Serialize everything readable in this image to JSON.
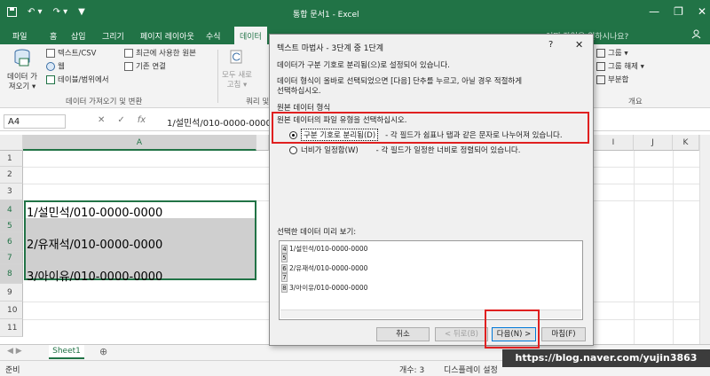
{
  "titlebar": {
    "title": "통합 문서1 - Excel",
    "qat": [
      "↶ ▾",
      "↷ ▾",
      "▼"
    ],
    "controls": [
      "—",
      "❐",
      "✕"
    ]
  },
  "tabs": [
    {
      "label": "파일"
    },
    {
      "label": "홈"
    },
    {
      "label": "삽입"
    },
    {
      "label": "그리기"
    },
    {
      "label": "페이지 레이아웃"
    },
    {
      "label": "수식"
    },
    {
      "label": "데이터"
    }
  ],
  "tell_me": "어떤 작업을 원하시나요?",
  "ribbon": {
    "get_data": "데이터 가\n져오기 ▾",
    "from_text_csv": "텍스트/CSV",
    "from_web": "웹",
    "from_table": "테이블/범위에서",
    "recent_sources": "최근에 사용한 원본",
    "existing_connections": "기존 연결",
    "group_get_transform": "데이터 가져오기 및 변환",
    "refresh_all": "모두 새로\n고침 ▾",
    "group_queries": "쿼리 및",
    "group": "그룹 ▾",
    "ungroup": "그룹 해제 ▾",
    "subtotal": "부분합",
    "group_outline": "개요"
  },
  "formula_bar": {
    "name_box": "A4",
    "cancel": "✕",
    "enter": "✓",
    "fx": "fx",
    "formula": "1/설민석/010-0000-0000"
  },
  "columns": [
    "A",
    "I",
    "J",
    "K"
  ],
  "rows": [
    "1",
    "2",
    "3",
    "4",
    "5",
    "6",
    "7",
    "8",
    "9",
    "10",
    "11"
  ],
  "cells": {
    "a4": "1/설민석/010-0000-0000",
    "a6": "2/유재석/010-0000-0000",
    "a8": "3/아이유/010-0000-0000"
  },
  "sheet": {
    "tab": "Sheet1",
    "add": "⊕"
  },
  "status": {
    "ready": "준비",
    "count": "개수: 3",
    "display_settings": "디스플레이 설정"
  },
  "dialog": {
    "title": "텍스트 마법사 - 3단계 중 1단계",
    "help": "?",
    "close": "✕",
    "line1": "데이터가 구분 기호로 분리됨(으)로 설정되어 있습니다.",
    "line2": "데이터 형식이 올바로 선택되었으면 [다음] 단추를 누르고, 아닐 경우 적절하게",
    "line3": "선택하십시오.",
    "section": "원본 데이터 형식",
    "choose": "원본 데이터의 파일 유형을 선택하십시오.",
    "opt1_label": "구분 기호로 분리됨(D)",
    "opt1_desc": "- 각 필드가 쉼표나 탭과 같은 문자로 나누어져 있습니다.",
    "opt2_label": "너비가 일정함(W)",
    "opt2_desc": "- 각 필드가 일정한 너비로 정렬되어 있습니다.",
    "preview_label": "선택한 데이터 미리 보기:",
    "preview_rows": [
      {
        "num": "4",
        "text": "1/설민석/010-0000-0000"
      },
      {
        "num": "5",
        "text": ""
      },
      {
        "num": "6",
        "text": "2/유재석/010-0000-0000"
      },
      {
        "num": "7",
        "text": ""
      },
      {
        "num": "8",
        "text": "3/아이유/010-0000-0000"
      }
    ],
    "btn_cancel": "취소",
    "btn_back": "< 뒤로(B)",
    "btn_next": "다음(N) >",
    "btn_finish": "마침(F)"
  },
  "watermark": "https://blog.naver.com/yujin3863",
  "colors": {
    "excel_green": "#217346",
    "highlight_red": "#e02020"
  }
}
